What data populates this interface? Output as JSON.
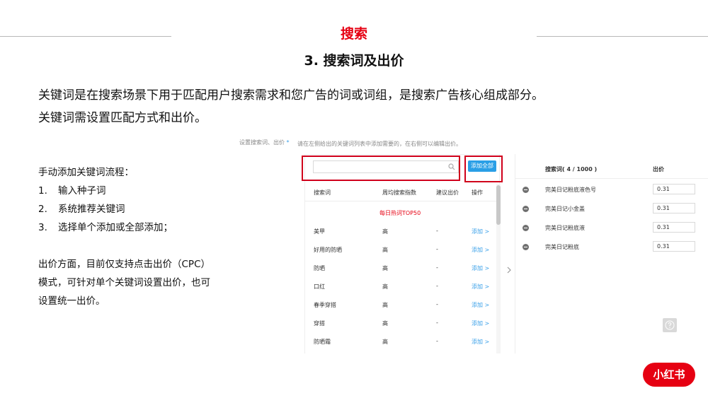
{
  "header": {
    "section_label": "搜索",
    "title": "3. 搜索词及出价"
  },
  "intro": {
    "line1": "关键词是在搜索场景下用于匹配用户搜索需求和您广告的词或词组，是搜索广告核心组成部分。",
    "line2": "关键词需设置匹配方式和出价。"
  },
  "sidebar_text": {
    "flow_title": "手动添加关键词流程：",
    "steps": [
      {
        "num": "1.",
        "text": "输入种子词"
      },
      {
        "num": "2.",
        "text": "系统推荐关键词"
      },
      {
        "num": "3.",
        "text": "选择单个添加或全部添加；"
      }
    ],
    "bid_para": [
      "出价方面，目前仅支持点击出价（CPC）",
      "模式，可针对单个关键词设置出价，也可",
      "设置统一出价。"
    ]
  },
  "form": {
    "field_label": "设置搜索词、出价",
    "required_mark": "*",
    "instruction": "请在左侧给出的关键词列表中添加需要的，在右侧可以编辑出价。",
    "search_placeholder": "",
    "add_all_label": "添加全部",
    "left_table": {
      "columns": [
        "搜索词",
        "周均搜索指数",
        "建议出价",
        "操作"
      ],
      "section_label": "每日热词TOP50",
      "rows": [
        {
          "keyword": "美甲",
          "index": "高",
          "bid": "-",
          "action": "添加 >"
        },
        {
          "keyword": "好用的防晒",
          "index": "高",
          "bid": "-",
          "action": "添加 >"
        },
        {
          "keyword": "防晒",
          "index": "高",
          "bid": "-",
          "action": "添加 >"
        },
        {
          "keyword": "口红",
          "index": "高",
          "bid": "-",
          "action": "添加 >"
        },
        {
          "keyword": "春季穿搭",
          "index": "高",
          "bid": "-",
          "action": "添加 >"
        },
        {
          "keyword": "穿搭",
          "index": "高",
          "bid": "-",
          "action": "添加 >"
        },
        {
          "keyword": "防晒霜",
          "index": "高",
          "bid": "-",
          "action": "添加 >"
        }
      ]
    },
    "right_table": {
      "col_keyword": "搜索词( 4 / 1000 )",
      "col_bid": "出价",
      "rows": [
        {
          "keyword": "完美日记粉底液色号",
          "bid": "0.31"
        },
        {
          "keyword": "完美日记小金盖",
          "bid": "0.31"
        },
        {
          "keyword": "完美日记粉底液",
          "bid": "0.31"
        },
        {
          "keyword": "完美日记粉底",
          "bid": "0.31"
        }
      ]
    }
  },
  "logo": {
    "text": "小红书"
  },
  "colors": {
    "brand_red": "#e60012",
    "highlight_red": "#d0001b",
    "link_blue": "#3aa0e8"
  },
  "icons": [
    "search-icon",
    "chevron-right-icon",
    "minus-circle-icon",
    "help-icon"
  ]
}
